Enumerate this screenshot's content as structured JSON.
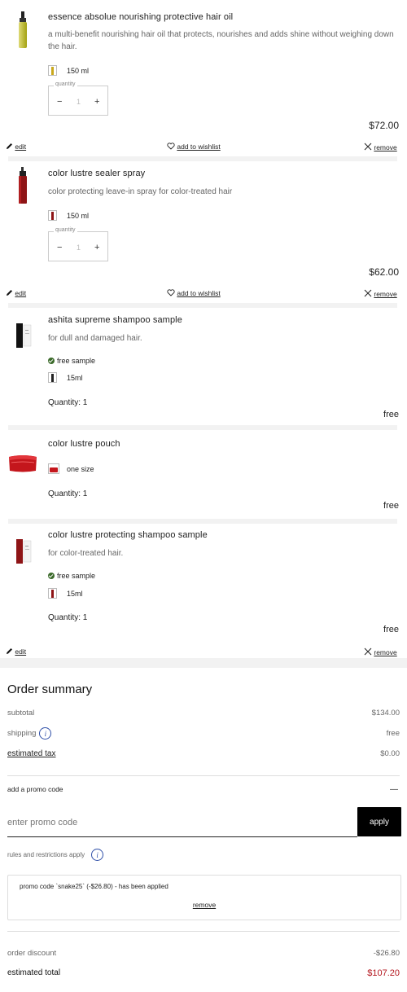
{
  "items": [
    {
      "title": "essence absolue nourishing protective hair oil",
      "description": "a multi-benefit nourishing hair oil that protects, nourishes and adds shine without weighing down the hair.",
      "size": "150 ml",
      "quantity_label": "quantity",
      "quantity": "1",
      "price": "$72.00",
      "edit": "edit",
      "wishlist": "add to wishlist",
      "remove": "remove"
    },
    {
      "title": "color lustre sealer spray",
      "description": "color protecting leave-in spray for color-treated hair",
      "size": "150 ml",
      "quantity_label": "quantity",
      "quantity": "1",
      "price": "$62.00",
      "edit": "edit",
      "wishlist": "add to wishlist",
      "remove": "remove"
    },
    {
      "title": "ashita supreme shampoo sample",
      "description": "for dull and damaged hair.",
      "badge": "free sample",
      "size": "15ml",
      "quantity": "Quantity: 1",
      "price": "free"
    },
    {
      "title": "color lustre pouch",
      "size": "one size",
      "quantity": "Quantity: 1",
      "price": "free"
    },
    {
      "title": "color lustre protecting shampoo sample",
      "description": "for color-treated hair.",
      "badge": "free sample",
      "size": "15ml",
      "quantity": "Quantity: 1",
      "price": "free",
      "edit": "edit",
      "remove": "remove"
    }
  ],
  "summary": {
    "heading": "Order summary",
    "subtotal_label": "subtotal",
    "subtotal": "$134.00",
    "shipping_label": "shipping",
    "shipping": "free",
    "tax_label": "estimated tax",
    "tax": "$0.00",
    "promo_label": "add a promo code",
    "promo_toggle": "—",
    "promo_placeholder": "enter promo code",
    "apply": "apply",
    "rules": "rules and restrictions apply",
    "applied_message": "promo code `snake25` (-$26.80) - has been applied",
    "applied_remove": "remove",
    "discount_label": "order discount",
    "discount": "-$26.80",
    "total_label": "estimated total",
    "total": "$107.20"
  },
  "colors": {
    "total": "#b3141c",
    "apply_bg": "#000000",
    "info": "#2f4fa8",
    "sample_check": "#3b6a2a"
  },
  "icons": [
    "pencil-icon",
    "heart-icon",
    "close-icon",
    "info-icon",
    "check-circle-icon"
  ]
}
